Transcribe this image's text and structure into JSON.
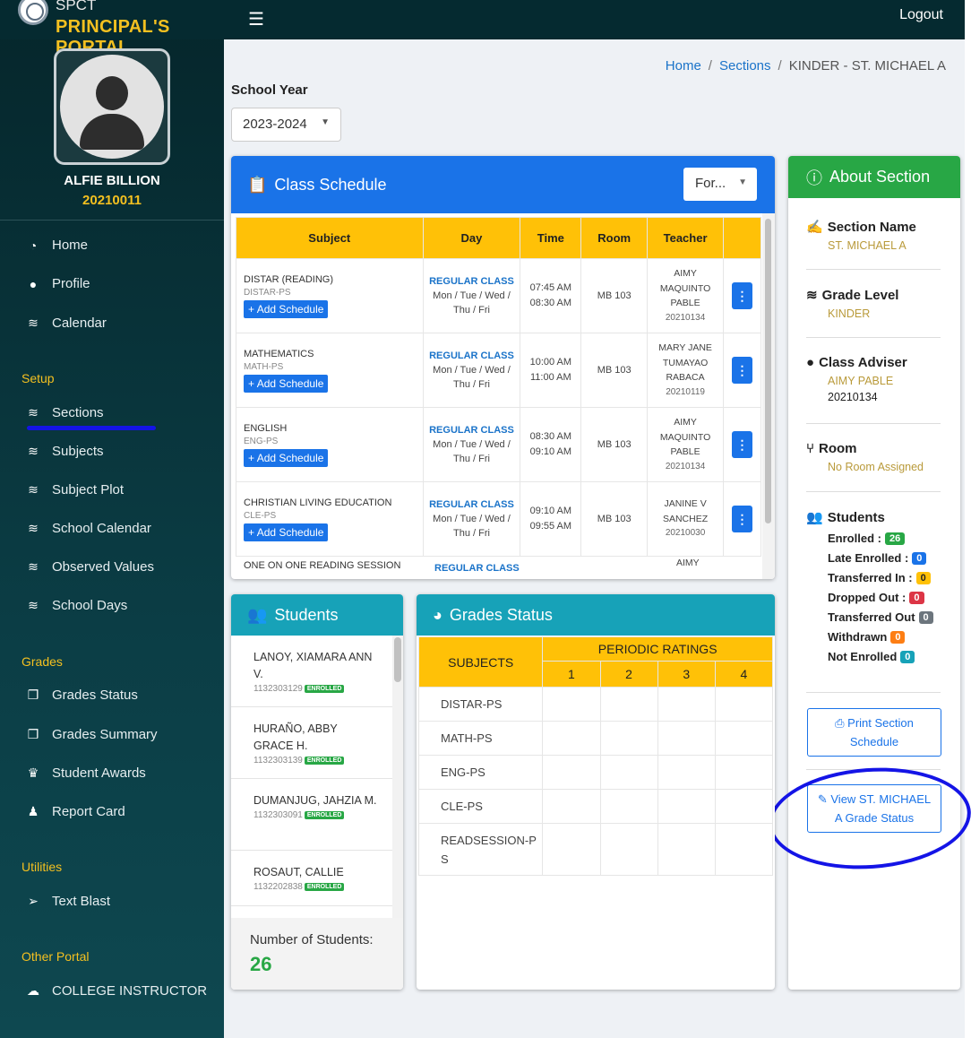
{
  "brand": {
    "small": "SPCT",
    "title": "PRINCIPAL'S PORTAL"
  },
  "user": {
    "name": "ALFIE BILLION",
    "id": "20210011"
  },
  "nav": {
    "home": "Home",
    "profile": "Profile",
    "calendar": "Calendar",
    "setup_label": "Setup",
    "sections": "Sections",
    "subjects": "Subjects",
    "subject_plot": "Subject Plot",
    "school_calendar": "School Calendar",
    "observed_values": "Observed Values",
    "school_days": "School Days",
    "grades_label": "Grades",
    "grades_status": "Grades Status",
    "grades_summary": "Grades Summary",
    "student_awards": "Student Awards",
    "report_card": "Report Card",
    "utilities_label": "Utilities",
    "text_blast": "Text Blast",
    "other_label": "Other Portal",
    "college_instructor": "COLLEGE INSTRUCTOR"
  },
  "topbar": {
    "logout": "Logout"
  },
  "breadcrumb": {
    "home": "Home",
    "sections": "Sections",
    "current": "KINDER - ST. MICHAEL A"
  },
  "school_year": {
    "label": "School Year",
    "value": "2023-2024"
  },
  "schedule": {
    "title": "Class Schedule",
    "filter": "For...",
    "headers": {
      "subject": "Subject",
      "day": "Day",
      "time": "Time",
      "room": "Room",
      "teacher": "Teacher"
    },
    "add_label": "Add Schedule",
    "rows": [
      {
        "name": "DISTAR (READING)",
        "code": "DISTAR-PS",
        "class": "REGULAR CLASS",
        "days1": "Mon / Tue / Wed /",
        "days2": "Thu / Fri",
        "start": "07:45 AM",
        "end": "08:30 AM",
        "room": "MB 103",
        "t1": "AIMY",
        "t2": "MAQUINTO",
        "t3": "PABLE",
        "tid": "20210134"
      },
      {
        "name": "MATHEMATICS",
        "code": "MATH-PS",
        "class": "REGULAR CLASS",
        "days1": "Mon / Tue / Wed /",
        "days2": "Thu / Fri",
        "start": "10:00 AM",
        "end": "11:00 AM",
        "room": "MB 103",
        "t1": "MARY JANE",
        "t2": "TUMAYAO",
        "t3": "RABACA",
        "tid": "20210119"
      },
      {
        "name": "ENGLISH",
        "code": "ENG-PS",
        "class": "REGULAR CLASS",
        "days1": "Mon / Tue / Wed /",
        "days2": "Thu / Fri",
        "start": "08:30 AM",
        "end": "09:10 AM",
        "room": "MB 103",
        "t1": "AIMY",
        "t2": "MAQUINTO",
        "t3": "PABLE",
        "tid": "20210134"
      },
      {
        "name": "CHRISTIAN LIVING EDUCATION",
        "code": "CLE-PS",
        "class": "REGULAR CLASS",
        "days1": "Mon / Tue / Wed /",
        "days2": "Thu / Fri",
        "start": "09:10 AM",
        "end": "09:55 AM",
        "room": "MB 103",
        "t1": "JANINE V",
        "t2": "SANCHEZ",
        "t3": "",
        "tid": "20210030"
      }
    ],
    "partial": {
      "name": "ONE ON ONE READING SESSION",
      "class": "REGULAR CLASS",
      "t1": "AIMY"
    }
  },
  "about": {
    "title": "About Section",
    "section_name_label": "Section Name",
    "section_name": "ST. MICHAEL A",
    "grade_level_label": "Grade Level",
    "grade_level": "KINDER",
    "adviser_label": "Class Adviser",
    "adviser_name": "AIMY PABLE",
    "adviser_id": "20210134",
    "room_label": "Room",
    "room": "No Room Assigned",
    "students_label": "Students",
    "stats": [
      {
        "label": "Enrolled :",
        "count": "26"
      },
      {
        "label": "Late Enrolled :",
        "count": "0"
      },
      {
        "label": "Transferred In :",
        "count": "0"
      },
      {
        "label": "Dropped Out :",
        "count": "0"
      },
      {
        "label": "Transferred Out",
        "count": "0"
      },
      {
        "label": "Withdrawn",
        "count": "0"
      },
      {
        "label": "Not Enrolled",
        "count": "0"
      }
    ],
    "print_btn": "Print Section Schedule",
    "view_btn": "View ST. MICHAEL A Grade Status"
  },
  "students": {
    "title": "Students",
    "list": [
      {
        "name": "LANOY, XIAMARA ANN V.",
        "id": "1132303129",
        "status": "ENROLLED"
      },
      {
        "name": "HURAÑO, ABBY GRACE H.",
        "id": "1132303139",
        "status": "ENROLLED"
      },
      {
        "name": "DUMANJUG, JAHZIA M.",
        "id": "1132303091",
        "status": "ENROLLED"
      },
      {
        "name": "ROSAUT, CALLIE",
        "id": "1132202838",
        "status": "ENROLLED"
      }
    ],
    "count_label": "Number of Students:",
    "count": "26"
  },
  "grades": {
    "title": "Grades Status",
    "subjects_header": "SUBJECTS",
    "periodic_header": "PERIODIC RATINGS",
    "periods": [
      "1",
      "2",
      "3",
      "4"
    ],
    "subjects": [
      "DISTAR-PS",
      "MATH-PS",
      "ENG-PS",
      "CLE-PS",
      "READSESSION-PS"
    ]
  },
  "colors": {
    "primary": "#1a73e8",
    "success": "#28a745",
    "warning": "#ffc107",
    "info": "#17a2b8",
    "sidebar": "#0b3d45",
    "accent": "#f4c020"
  }
}
